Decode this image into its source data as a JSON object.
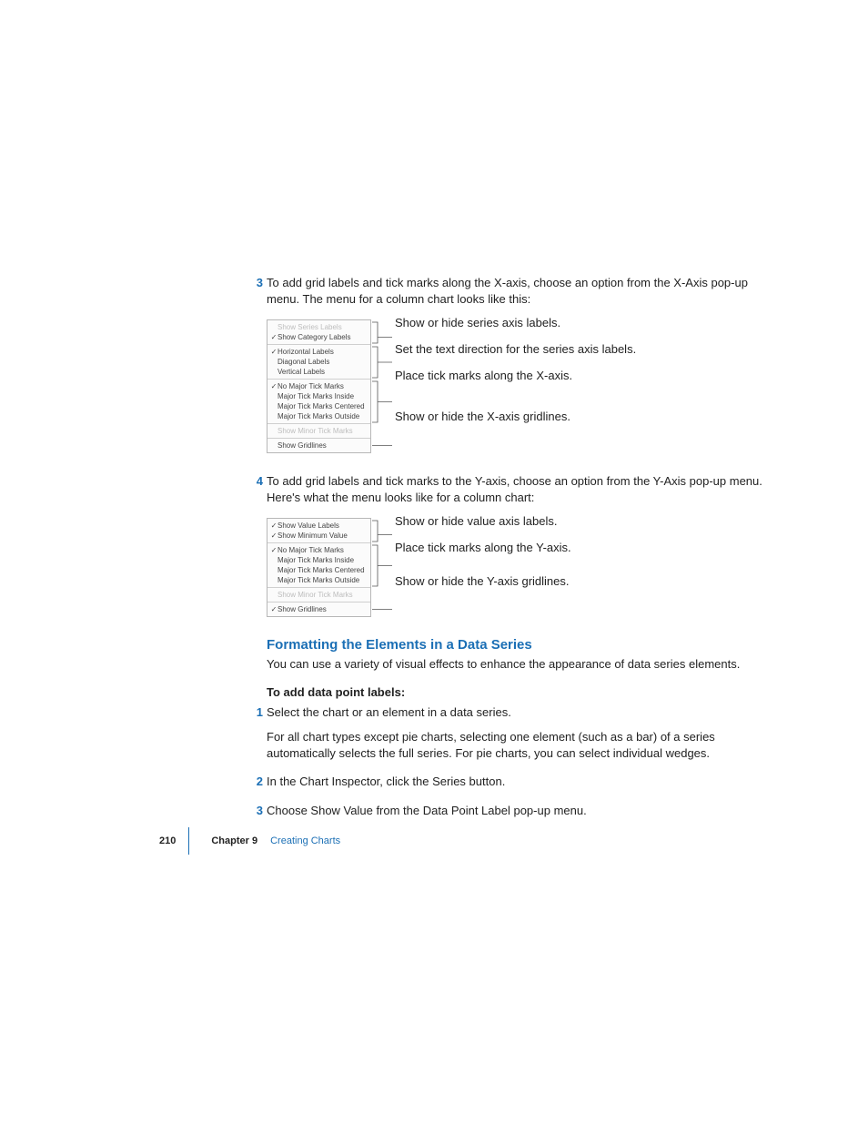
{
  "steps": {
    "s3_num": "3",
    "s3_text": "To add grid labels and tick marks along the X-axis, choose an option from the X-Axis pop-up menu. The menu for a column chart looks like this:",
    "s4_num": "4",
    "s4_text": "To add grid labels and tick marks to the Y-axis, choose an option from the Y-Axis pop-up menu. Here's what the menu looks like for a column chart:"
  },
  "xmenu": {
    "g1": [
      {
        "checked": false,
        "label": "Show Series Labels",
        "disabled": true
      },
      {
        "checked": true,
        "label": "Show Category Labels",
        "disabled": false
      }
    ],
    "g2": [
      {
        "checked": true,
        "label": "Horizontal Labels",
        "disabled": false
      },
      {
        "checked": false,
        "label": "Diagonal Labels",
        "disabled": false
      },
      {
        "checked": false,
        "label": "Vertical Labels",
        "disabled": false
      }
    ],
    "g3": [
      {
        "checked": true,
        "label": "No Major Tick Marks",
        "disabled": false
      },
      {
        "checked": false,
        "label": "Major Tick Marks Inside",
        "disabled": false
      },
      {
        "checked": false,
        "label": "Major Tick Marks Centered",
        "disabled": false
      },
      {
        "checked": false,
        "label": "Major Tick Marks Outside",
        "disabled": false
      }
    ],
    "g4": [
      {
        "checked": false,
        "label": "Show Minor Tick Marks",
        "disabled": true
      }
    ],
    "g5": [
      {
        "checked": false,
        "label": "Show Gridlines",
        "disabled": false
      }
    ]
  },
  "xcallouts": {
    "c1": "Show or hide series axis labels.",
    "c2": "Set the text direction for the series axis labels.",
    "c3": "Place tick marks along the X-axis.",
    "c4": "Show or hide the X-axis gridlines."
  },
  "ymenu": {
    "g1": [
      {
        "checked": true,
        "label": "Show Value Labels",
        "disabled": false
      },
      {
        "checked": true,
        "label": "Show Minimum Value",
        "disabled": false
      }
    ],
    "g2": [
      {
        "checked": true,
        "label": "No Major Tick Marks",
        "disabled": false
      },
      {
        "checked": false,
        "label": "Major Tick Marks Inside",
        "disabled": false
      },
      {
        "checked": false,
        "label": "Major Tick Marks Centered",
        "disabled": false
      },
      {
        "checked": false,
        "label": "Major Tick Marks Outside",
        "disabled": false
      }
    ],
    "g3": [
      {
        "checked": false,
        "label": "Show Minor Tick Marks",
        "disabled": true
      }
    ],
    "g4": [
      {
        "checked": true,
        "label": "Show Gridlines",
        "disabled": false
      }
    ]
  },
  "ycallouts": {
    "c1": "Show or hide value axis labels.",
    "c2": "Place tick marks along the Y-axis.",
    "c3": "Show or hide the Y-axis gridlines."
  },
  "section": {
    "head": "Formatting the Elements in a Data Series",
    "intro": "You can use a variety of visual effects to enhance the appearance of data series elements.",
    "lead": "To add data point labels:",
    "s1_num": "1",
    "s1_text": "Select the chart or an element in a data series.",
    "s1_para": "For all chart types except pie charts, selecting one element (such as a bar) of a series automatically selects the full series. For pie charts, you can select individual wedges.",
    "s2_num": "2",
    "s2_text": "In the Chart Inspector, click the Series button.",
    "s3_num": "3",
    "s3_text": "Choose Show Value from the Data Point Label pop-up menu."
  },
  "footer": {
    "page": "210",
    "chapter": "Chapter 9",
    "title": "Creating Charts"
  }
}
